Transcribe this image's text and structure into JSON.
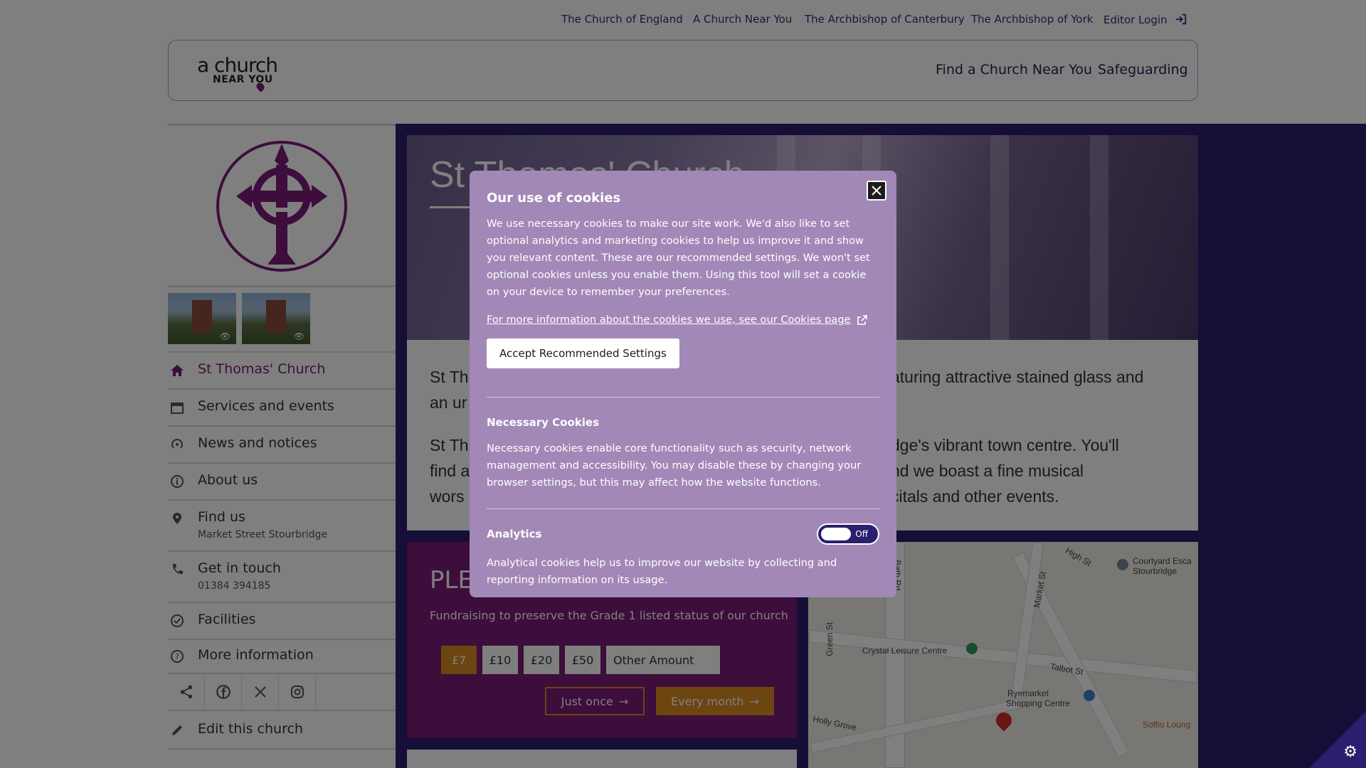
{
  "topnav": {
    "links": [
      "The Church of England",
      "A Church Near You",
      "The Archbishop of Canterbury",
      "The Archbishop of York"
    ],
    "login": "Editor Login"
  },
  "header": {
    "logo_line1": "a church",
    "logo_line2": "NEAR YOU",
    "nav": [
      "Find a Church Near You",
      "Safeguarding"
    ]
  },
  "sidebar": {
    "items": [
      {
        "label": "St Thomas' Church",
        "icon": "home-icon",
        "sub": ""
      },
      {
        "label": "Services and events",
        "icon": "calendar-icon",
        "sub": ""
      },
      {
        "label": "News and notices",
        "icon": "broadcast-icon",
        "sub": ""
      },
      {
        "label": "About us",
        "icon": "info-icon",
        "sub": ""
      },
      {
        "label": "Find us",
        "icon": "location-pin-icon",
        "sub": "Market Street Stourbridge"
      },
      {
        "label": "Get in touch",
        "icon": "phone-icon",
        "sub": "01384 394185"
      },
      {
        "label": "Facilities",
        "icon": "check-circle-icon",
        "sub": ""
      },
      {
        "label": "More information",
        "icon": "question-circle-icon",
        "sub": ""
      }
    ],
    "edit": "Edit this church"
  },
  "hero": {
    "title": "St Thomas' Church"
  },
  "intro": {
    "p1_left": "St Th",
    "p1_right": "aturing attractive stained glass and",
    "p1_line2": "an ur",
    "p2_left1": "St Th",
    "p2_right1": "dge's vibrant town centre. You'll",
    "p2_left2": "find a",
    "p2_right2": "nd we boast a fine musical",
    "p2_left3": "wors",
    "p2_right3": "citals and other events."
  },
  "pledge": {
    "heading": "PLE",
    "fundraising": "Fundraising to preserve the Grade 1 listed status of our church",
    "amounts": [
      "£7",
      "£10",
      "£20",
      "£50"
    ],
    "other_placeholder": "Other Amount",
    "once": "Just once",
    "month": "Every month"
  },
  "map": {
    "labels": [
      "Courtyard Esca",
      "Stourbridge",
      "Crystal Leisure Centre",
      "Ryemarket",
      "Shopping Centre",
      "Soffio Loung",
      "Talbot St",
      "High St",
      "Market St",
      "Green St",
      "Holly Grove",
      "Bath Rd"
    ]
  },
  "cookies": {
    "title": "Our use of cookies",
    "intro": "We use necessary cookies to make our site work. We'd also like to set optional analytics and marketing cookies to help us improve it and show you relevant content. These are our recommended settings. We won't set optional cookies unless you enable them. Using this tool will set a cookie on your device to remember your preferences.",
    "more_link": "For more information about the cookies we use, see our Cookies page",
    "accept": "Accept Recommended Settings",
    "necessary_title": "Necessary Cookies",
    "necessary_desc": "Necessary cookies enable core functionality such as security, network management and accessibility. You may disable these by changing your browser settings, but this may affect how the website functions.",
    "analytics_title": "Analytics",
    "analytics_toggle": "Off",
    "analytics_desc": "Analytical cookies help us to improve our website by collecting and reporting information on its usage."
  },
  "colors": {
    "brand_purple": "#7a1a76",
    "navy": "#2a1f6e",
    "modal_bg": "#a288b7",
    "accent_orange": "#d98a20"
  }
}
